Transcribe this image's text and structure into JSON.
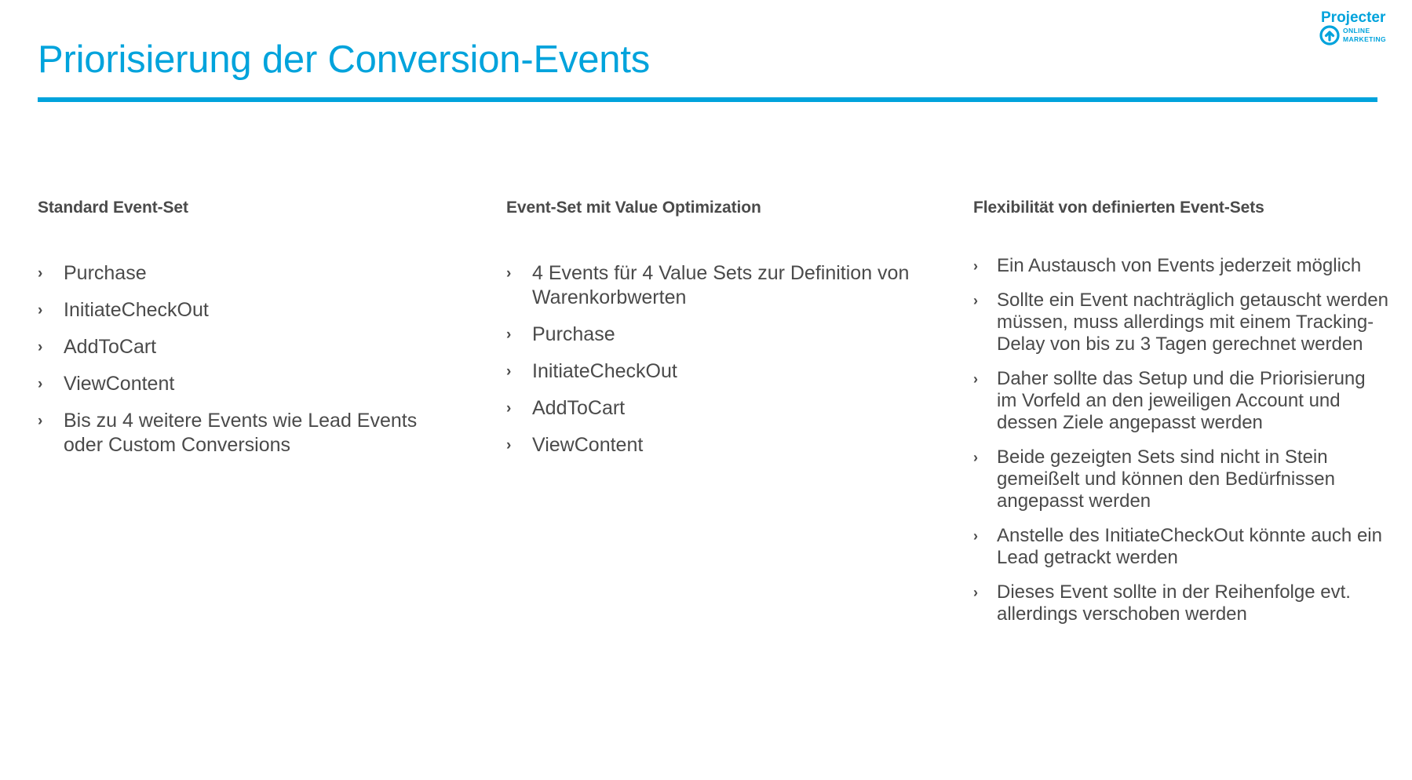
{
  "brand": {
    "accent_color": "#00a3dc",
    "text_color": "#4a4a4a",
    "logo_wordmark": "Projecter",
    "logo_tagline_line1": "ONLINE",
    "logo_tagline_line2": "MARKETING"
  },
  "header": {
    "title": "Priorisierung der Conversion-Events"
  },
  "bullet_marker": "›",
  "columns": [
    {
      "heading": "Standard Event-Set",
      "items": [
        "Purchase",
        "InitiateCheckOut",
        "AddToCart",
        "ViewContent",
        "Bis zu 4 weitere Events wie Lead Events oder Custom Conversions"
      ]
    },
    {
      "heading": "Event-Set mit Value Optimization",
      "items": [
        "4 Events für 4 Value Sets zur Definition von Warenkorbwerten",
        "Purchase",
        "InitiateCheckOut",
        "AddToCart",
        "ViewContent"
      ]
    },
    {
      "heading": "Flexibilität von definierten Event-Sets",
      "items": [
        "Ein Austausch von Events jederzeit möglich",
        "Sollte ein Event nachträglich getauscht werden müssen, muss allerdings mit einem Tracking-Delay von bis zu 3 Tagen gerechnet werden",
        "Daher sollte das Setup und die Priorisierung im Vorfeld an den jeweiligen Account und dessen Ziele angepasst werden",
        "Beide gezeigten Sets sind nicht in Stein gemeißelt und können den Bedürfnissen angepasst werden",
        "Anstelle des InitiateCheckOut könnte auch ein Lead getrackt werden",
        "Dieses Event sollte in der Reihenfolge evt. allerdings verschoben werden"
      ]
    }
  ]
}
